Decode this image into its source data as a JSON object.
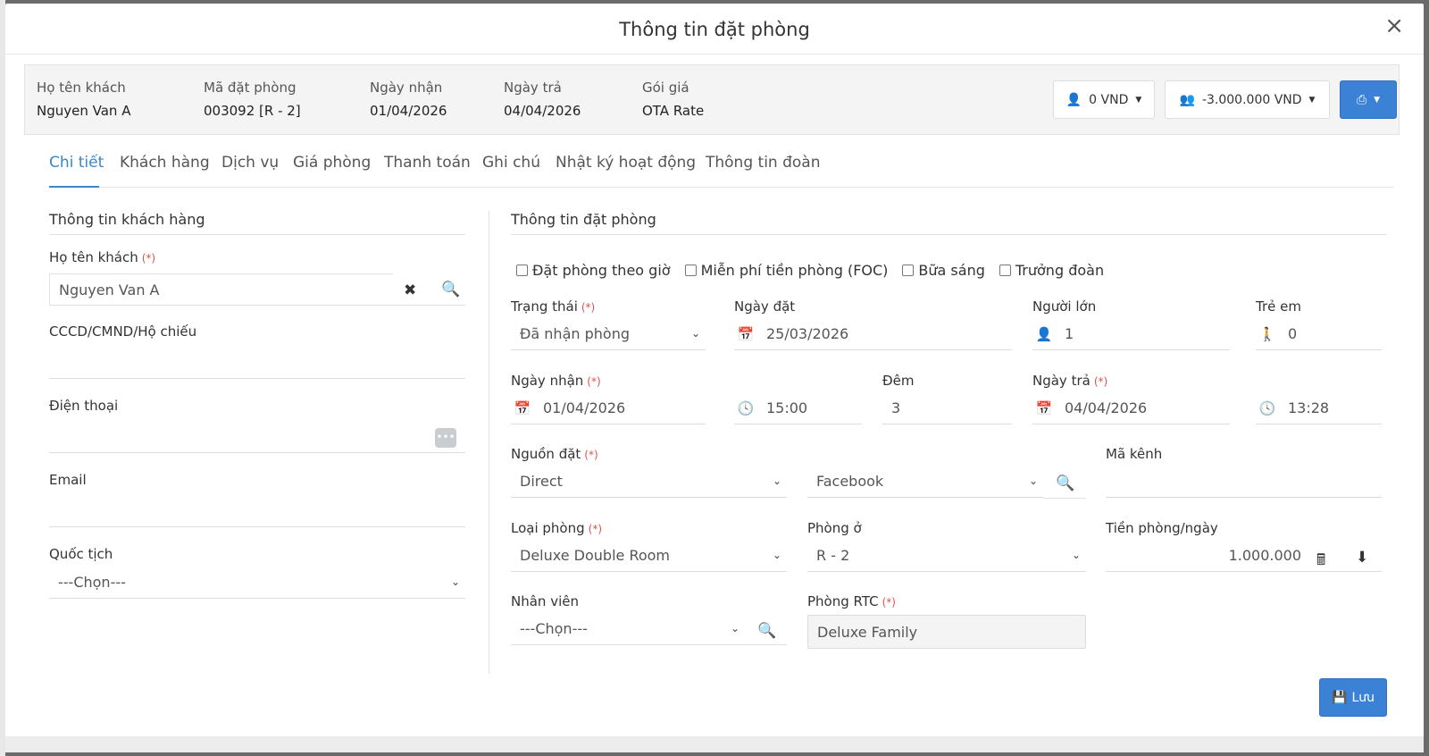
{
  "modal": {
    "title": "Thông tin đặt phòng",
    "close": "×"
  },
  "summary": {
    "guest_label": "Họ tên khách",
    "guest_value": "Nguyen Van A",
    "code_label": "Mã đặt phòng",
    "code_value": "003092 [R - 2]",
    "checkin_label": "Ngày nhận",
    "checkin_value": "01/04/2026",
    "checkout_label": "Ngày trả",
    "checkout_value": "04/04/2026",
    "rate_label": "Gói giá",
    "rate_value": "OTA Rate",
    "btn_personal": "0 VND",
    "btn_group": "-3.000.000 VND"
  },
  "tabs": [
    "Chi tiết",
    "Khách hàng",
    "Dịch vụ",
    "Giá phòng",
    "Thanh toán",
    "Ghi chú",
    "Nhật ký hoạt động",
    "Thông tin đoàn"
  ],
  "customer": {
    "section_title": "Thông tin khách hàng",
    "name_label": "Họ tên khách",
    "required": "(*)",
    "name_value": "Nguyen Van A",
    "id_label": "CCCD/CMND/Hộ chiếu",
    "id_value": "",
    "phone_label": "Điện thoại",
    "phone_value": "",
    "email_label": "Email",
    "email_value": "",
    "nationality_label": "Quốc tịch",
    "nationality_value": "---Chọn---"
  },
  "booking": {
    "section_title": "Thông tin đặt phòng",
    "checkboxes": [
      "Đặt phòng theo giờ",
      "Miễn phí tiền phòng (FOC)",
      "Bữa sáng",
      "Trưởng đoàn"
    ],
    "status_label": "Trạng thái",
    "status_value": "Đã nhận phòng",
    "booked_date_label": "Ngày đặt",
    "booked_date_value": "25/03/2026",
    "adults_label": "Người lớn",
    "adults_value": "1",
    "children_label": "Trẻ em",
    "children_value": "0",
    "checkin_label": "Ngày nhận",
    "checkin_date": "01/04/2026",
    "checkin_time": "15:00",
    "nights_label": "Đêm",
    "nights_value": "3",
    "checkout_label": "Ngày trả",
    "checkout_date": "04/04/2026",
    "checkout_time": "13:28",
    "source_label": "Nguồn đặt",
    "source_value": "Direct",
    "source_sub_value": "Facebook",
    "channel_code_label": "Mã kênh",
    "channel_code_value": "",
    "room_type_label": "Loại phòng",
    "room_type_value": "Deluxe Double Room",
    "room_label": "Phòng ở",
    "room_value": "R - 2",
    "room_rate_label": "Tiền phòng/ngày",
    "room_rate_value": "1.000.000",
    "staff_label": "Nhân viên",
    "staff_value": "---Chọn---",
    "rtc_room_label": "Phòng RTC",
    "rtc_room_value": "Deluxe Family",
    "save_label": "Lưu"
  }
}
